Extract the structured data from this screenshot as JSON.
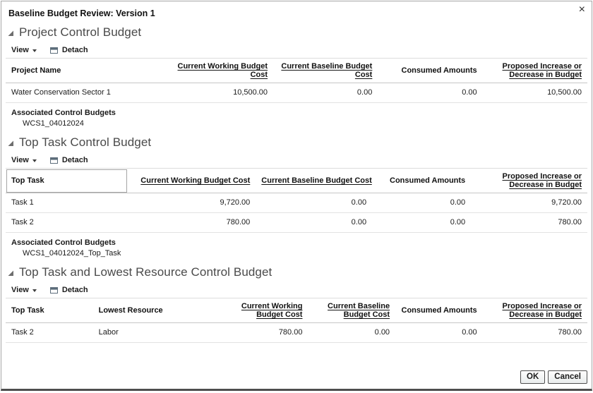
{
  "dialog": {
    "title": "Baseline Budget Review: Version 1",
    "close": "×"
  },
  "toolbar": {
    "view": "View",
    "detach": "Detach"
  },
  "sections": [
    {
      "title": "Project Control Budget",
      "columns": [
        "Project Name",
        "Current Working Budget Cost",
        "Current Baseline Budget Cost",
        "Consumed Amounts",
        "Proposed Increase or Decrease in Budget"
      ],
      "rows": [
        [
          "Water Conservation Sector 1",
          "10,500.00",
          "0.00",
          "0.00",
          "10,500.00"
        ]
      ],
      "assoc_label": "Associated Control Budgets",
      "assoc_value": "WCS1_04012024"
    },
    {
      "title": "Top Task Control Budget",
      "columns": [
        "Top Task",
        "Current Working Budget Cost",
        "Current Baseline Budget Cost",
        "Consumed Amounts",
        "Proposed Increase or Decrease in Budget"
      ],
      "rows": [
        [
          "Task 1",
          "9,720.00",
          "0.00",
          "0.00",
          "9,720.00"
        ],
        [
          "Task 2",
          "780.00",
          "0.00",
          "0.00",
          "780.00"
        ]
      ],
      "assoc_label": "Associated Control Budgets",
      "assoc_value": "WCS1_04012024_Top_Task"
    },
    {
      "title": "Top Task and Lowest Resource Control Budget",
      "columns": [
        "Top Task",
        "Lowest Resource",
        "Current Working Budget Cost",
        "Current Baseline Budget Cost",
        "Consumed Amounts",
        "Proposed Increase or Decrease in Budget"
      ],
      "rows": [
        [
          "Task 2",
          "Labor",
          "780.00",
          "0.00",
          "0.00",
          "780.00"
        ]
      ]
    }
  ],
  "footer": {
    "ok": "OK",
    "cancel": "Cancel"
  }
}
